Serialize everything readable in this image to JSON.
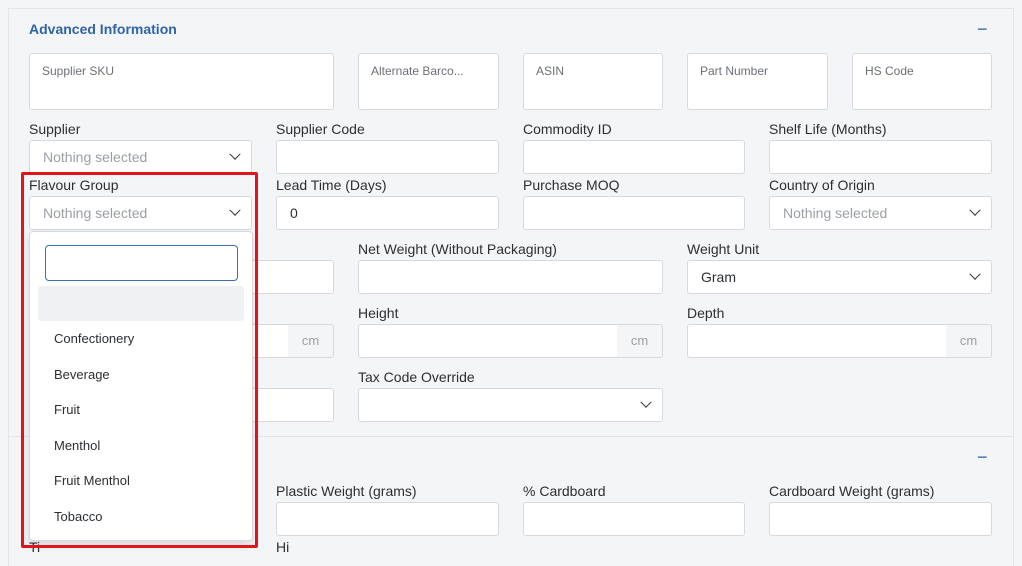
{
  "section": {
    "title": "Advanced Information",
    "collapse_symbol": "−"
  },
  "top_fields": [
    {
      "label": "Supplier SKU"
    },
    {
      "label": "Alternate Barco..."
    },
    {
      "label": "ASIN"
    },
    {
      "label": "Part Number"
    },
    {
      "label": "HS Code"
    }
  ],
  "row1": {
    "supplier": {
      "label": "Supplier",
      "placeholder": "Nothing selected"
    },
    "supplier_code": {
      "label": "Supplier Code"
    },
    "commodity_id": {
      "label": "Commodity ID"
    },
    "shelf_life": {
      "label": "Shelf Life (Months)"
    }
  },
  "row2": {
    "flavour_group": {
      "label": "Flavour Group",
      "placeholder": "Nothing selected"
    },
    "lead_time": {
      "label": "Lead Time (Days)",
      "value": "0"
    },
    "purchase_moq": {
      "label": "Purchase MOQ"
    },
    "country_of_origin": {
      "label": "Country of Origin",
      "placeholder": "Nothing selected"
    }
  },
  "row3": {
    "net_weight": {
      "label": "Net Weight (Without Packaging)"
    },
    "weight_unit": {
      "label": "Weight Unit",
      "value": "Gram"
    }
  },
  "row4": {
    "height": {
      "label": "Height",
      "unit": "cm"
    },
    "depth": {
      "label": "Depth",
      "unit": "cm"
    },
    "hidden_unit": "cm"
  },
  "row5": {
    "tax_code_override": {
      "label": "Tax Code Override"
    }
  },
  "section2": {
    "collapse_symbol": "−",
    "plastic_weight": {
      "label": "Plastic Weight (grams)"
    },
    "pct_cardboard": {
      "label": "% Cardboard"
    },
    "cardboard_weight": {
      "label": "Cardboard Weight (grams)"
    },
    "partial_left": "Ti",
    "partial_mid": "Hi"
  },
  "dropdown": {
    "options": [
      "Confectionery",
      "Beverage",
      "Fruit",
      "Menthol",
      "Fruit Menthol",
      "Tobacco"
    ]
  },
  "colors": {
    "accent": "#2f63a8",
    "highlight": "#e0151c"
  }
}
